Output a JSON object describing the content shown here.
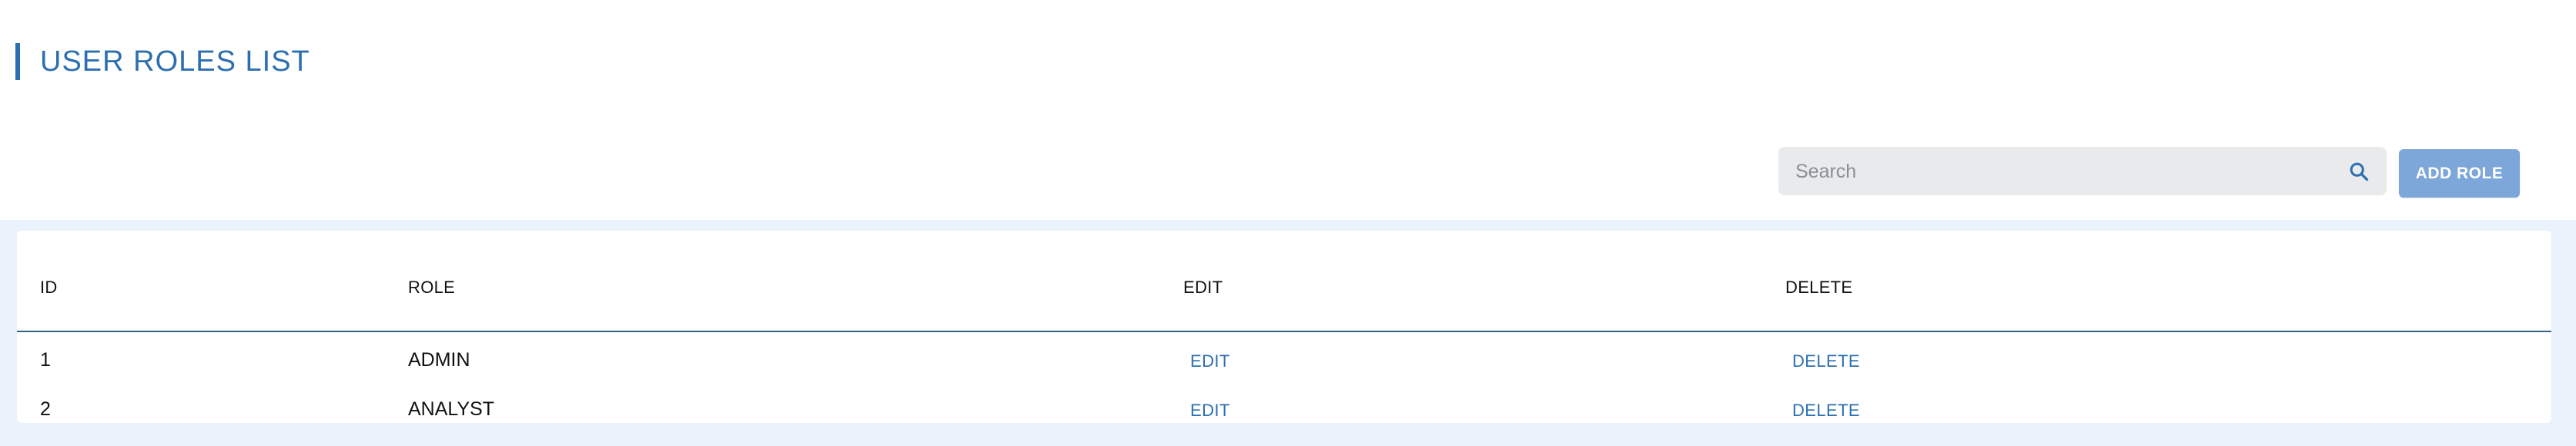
{
  "page": {
    "title": "USER ROLES LIST"
  },
  "toolbar": {
    "search_placeholder": "Search",
    "search_value": "",
    "add_role_label": "ADD ROLE"
  },
  "table": {
    "columns": [
      "ID",
      "ROLE",
      "EDIT",
      "DELETE"
    ],
    "rows": [
      {
        "id": "1",
        "role": "ADMIN",
        "edit": "EDIT",
        "delete": "DELETE"
      },
      {
        "id": "2",
        "role": "ANALYST",
        "edit": "EDIT",
        "delete": "DELETE"
      }
    ]
  },
  "colors": {
    "accent": "#2c6fb0",
    "button": "#7da6d9",
    "background": "#eaf2fc",
    "search_bg": "#e9eaec",
    "table_divider": "#2f6485"
  },
  "icons": {
    "search": "search-icon"
  }
}
